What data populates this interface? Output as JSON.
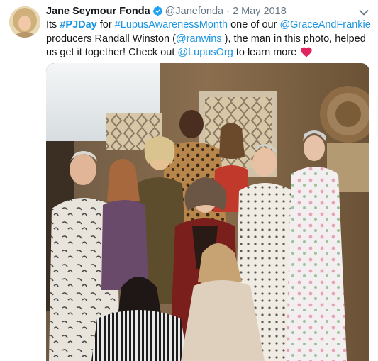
{
  "tweet": {
    "author_name": "Jane Seymour Fonda",
    "handle": "@Janefonda",
    "separator": "·",
    "date": "2 May 2018",
    "text": {
      "t1": "Its ",
      "hashtag1": "#PJDay",
      "t2": " for ",
      "hashtag2": "#LupusAwarenessMonth",
      "t3": " one of our ",
      "mention1": "@GraceAndFrankie",
      "t4": " producers Randall Winston (",
      "mention2": "@ranwins",
      "t5": " ), the man in this photo, helped us get it together! Check out ",
      "mention3": "@LupusOrg",
      "t6": " to learn more "
    }
  },
  "icons": {
    "verified": "verified-badge-icon",
    "caret": "chevron-down-icon",
    "heart": "red-heart-emoji"
  },
  "colors": {
    "link": "#1b95e0",
    "verified": "#1da1f2",
    "muted": "#657786",
    "heart": "#e0245e"
  }
}
